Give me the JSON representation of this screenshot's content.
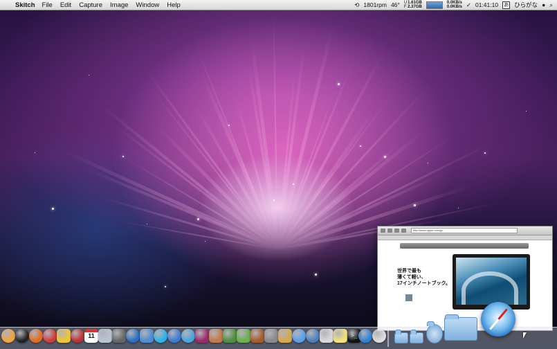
{
  "menubar": {
    "apple_symbol": "",
    "app_name": "Skitch",
    "menus": [
      "File",
      "Edit",
      "Capture",
      "Image",
      "Window",
      "Help"
    ],
    "status": {
      "fan_speed": "1801rpm",
      "temperature": "46°",
      "mem_u_label": "U",
      "mem_f_label": "F",
      "mem_used": "1.61GB",
      "mem_free": "2.37GB",
      "net_up": "0.0KB/s",
      "net_down": "0.0KB/s",
      "clock": "01:41:10",
      "input_method": "ひらがな"
    }
  },
  "skitch_window": {
    "url": "http://www.apple.com/jp/",
    "headline_lines": [
      "世界で最も",
      "薄くて軽い、",
      "17インチノートブック。"
    ]
  },
  "dock": {
    "calendar_day": "11",
    "items": [
      {
        "name": "finder-icon",
        "color": "#f1a43b"
      },
      {
        "name": "dashboard-icon",
        "color": "#222222"
      },
      {
        "name": "firefox-icon",
        "color": "#e36a1c"
      },
      {
        "name": "lifebuoy-icon",
        "color": "#d23b3b"
      },
      {
        "name": "adium-duck-icon",
        "color": "#f2c530"
      },
      {
        "name": "crossover-icon",
        "color": "#c03030"
      },
      {
        "name": "ical-icon",
        "color": "#ffffff"
      },
      {
        "name": "preview-icon",
        "color": "#b8c4d0"
      },
      {
        "name": "utility-icon",
        "color": "#666666"
      },
      {
        "name": "google-earth-icon",
        "color": "#2a6fc4"
      },
      {
        "name": "virtualbox-icon",
        "color": "#4d8dd1"
      },
      {
        "name": "skype-icon",
        "color": "#2bb3ea"
      },
      {
        "name": "itunes-icon",
        "color": "#3b7bd8"
      },
      {
        "name": "app-store-icon",
        "color": "#4aa4e0"
      },
      {
        "name": "silverlock-icon",
        "color": "#9a2a6a"
      },
      {
        "name": "photo-icon",
        "color": "#c27a46"
      },
      {
        "name": "flashcard-icon",
        "color": "#4f8f3e"
      },
      {
        "name": "textmate-icon",
        "color": "#6ab04c"
      },
      {
        "name": "guitar-icon",
        "color": "#a85a2a"
      },
      {
        "name": "disk-utility-icon",
        "color": "#8a8a8a"
      },
      {
        "name": "iphoto-icon",
        "color": "#d8a84a"
      },
      {
        "name": "music-icon",
        "color": "#5aa0e8"
      },
      {
        "name": "network-icon",
        "color": "#4a80c0"
      },
      {
        "name": "notes-icon",
        "color": "#d8d8d8"
      },
      {
        "name": "stickies-icon",
        "color": "#f5e27a"
      },
      {
        "name": "terminal-icon",
        "color": "#111111"
      },
      {
        "name": "safari-icon",
        "color": "#2c84d4"
      },
      {
        "name": "network-ball-icon",
        "color": "#dddddd"
      }
    ]
  }
}
